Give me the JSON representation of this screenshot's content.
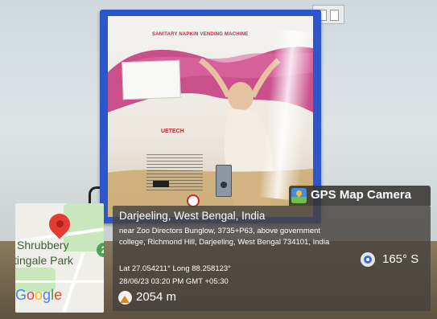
{
  "machine": {
    "title": "SANITARY NAPKIN VENDING MACHINE",
    "brand": "UETECH"
  },
  "watermark": {
    "app_name": "GPS Map Camera",
    "location": "Darjeeling, West Bengal, India",
    "address": "near Zoo Directors Bunglow, 3735+P63, above government college, Richmond Hill, Darjeeling, West Bengal 734101, India",
    "coordinates": "Lat 27.054211° Long 88.258123°",
    "datetime": "28/06/23 03:20 PM GMT +05:30",
    "altitude": "2054 m",
    "heading": "165° S"
  },
  "map": {
    "label_line1": "Shrubbery",
    "label_line2": "tingale Park",
    "badge": "2",
    "logo": "Google"
  },
  "icons": {
    "gps_app": "map-camera-icon",
    "location_pin": "map-pin-icon",
    "altitude": "mountain-icon",
    "compass": "compass-icon"
  }
}
